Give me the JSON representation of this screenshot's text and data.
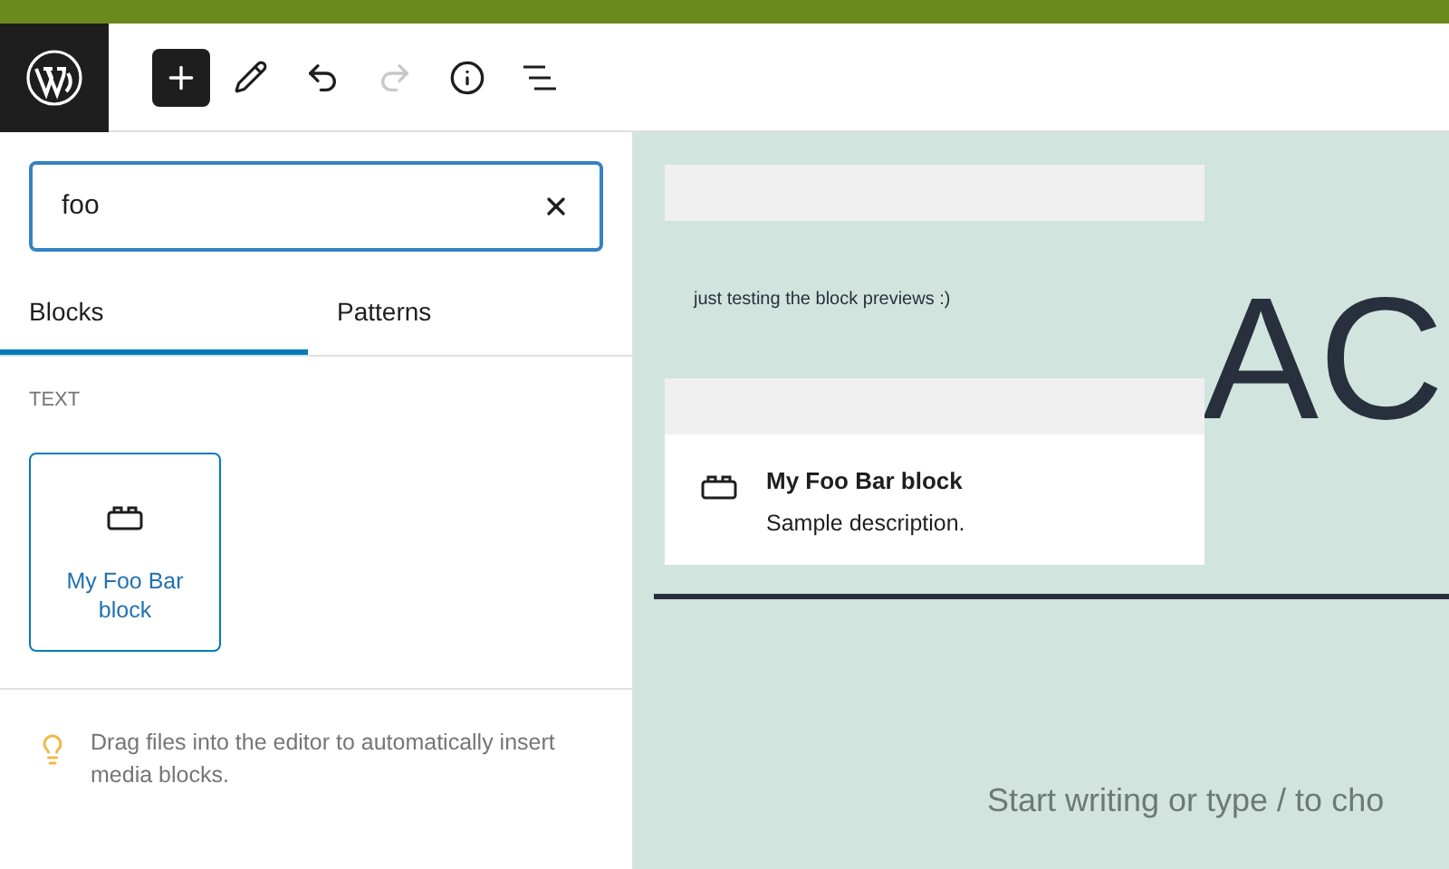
{
  "toolbar": {
    "buttons": [
      {
        "kind": "inserter",
        "selected": true
      },
      {
        "kind": "edit",
        "disabled": false
      },
      {
        "kind": "undo",
        "disabled": false
      },
      {
        "kind": "redo",
        "disabled": true
      },
      {
        "kind": "info",
        "disabled": false
      },
      {
        "kind": "outline",
        "disabled": false
      }
    ]
  },
  "inserter": {
    "search": {
      "value": "foo"
    },
    "tabs": [
      {
        "label": "Blocks",
        "selected": true
      },
      {
        "label": "Patterns",
        "selected": false
      }
    ],
    "category": "TEXT",
    "blocks": [
      {
        "label": "My Foo Bar block"
      }
    ],
    "tip": "Drag files into the editor to automatically insert media blocks."
  },
  "preview": {
    "text": "just testing the block previews :)",
    "block_title": "My Foo Bar block",
    "block_description": "Sample description."
  },
  "canvas": {
    "title": "AC",
    "placeholder": "Start writing or type / to cho"
  }
}
